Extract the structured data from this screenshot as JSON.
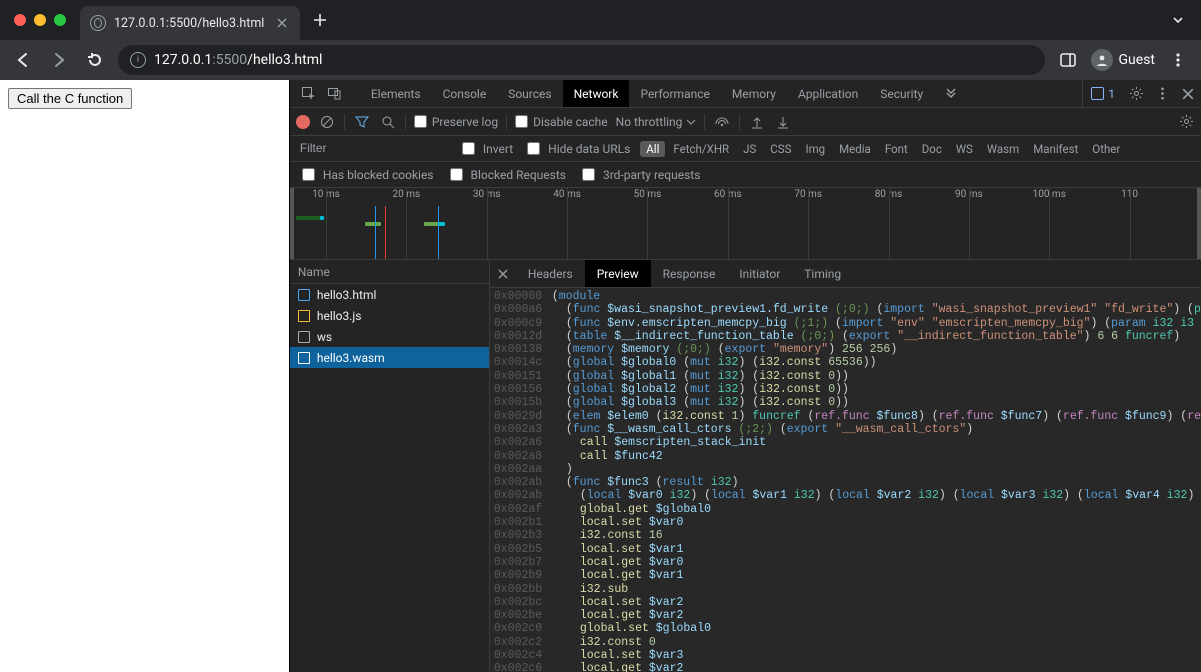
{
  "tab": {
    "title": "127.0.0.1:5500/hello3.html"
  },
  "omnibox": {
    "proto_and_port": ":5500",
    "host": "127.0.0.1",
    "path": "/hello3.html"
  },
  "guest_label": "Guest",
  "page": {
    "button_label": "Call the C function"
  },
  "devtools": {
    "tabs": [
      "Elements",
      "Console",
      "Sources",
      "Network",
      "Performance",
      "Memory",
      "Application",
      "Security"
    ],
    "active_tab_index": 3,
    "issues_count": "1",
    "net_toolbar": {
      "preserve_log": "Preserve log",
      "disable_cache": "Disable cache",
      "throttle": "No throttling"
    },
    "filter": {
      "placeholder": "Filter",
      "invert": "Invert",
      "hide_data_urls": "Hide data URLs",
      "chips": [
        "All",
        "Fetch/XHR",
        "JS",
        "CSS",
        "Img",
        "Media",
        "Font",
        "Doc",
        "WS",
        "Wasm",
        "Manifest",
        "Other"
      ],
      "active_chip_index": 0,
      "blocked_cookies": "Has blocked cookies",
      "blocked_requests": "Blocked Requests",
      "third_party": "3rd-party requests"
    },
    "timeline": {
      "ticks": [
        "10 ms",
        "20 ms",
        "30 ms",
        "40 ms",
        "50 ms",
        "60 ms",
        "70 ms",
        "80 ms",
        "90 ms",
        "100 ms",
        "110"
      ]
    },
    "reqlist": {
      "header": "Name",
      "items": [
        {
          "name": "hello3.html",
          "type": "html"
        },
        {
          "name": "hello3.js",
          "type": "js"
        },
        {
          "name": "ws",
          "type": "ws"
        },
        {
          "name": "hello3.wasm",
          "type": "wasm"
        }
      ],
      "selected_index": 3
    },
    "detail_tabs": [
      "Headers",
      "Preview",
      "Response",
      "Initiator",
      "Timing"
    ],
    "detail_active_index": 1,
    "wasm_preview": [
      {
        "addr": "0x00000",
        "indent": 0,
        "tokens": [
          [
            "pl",
            "("
          ],
          [
            "kw",
            "module"
          ]
        ]
      },
      {
        "addr": "0x000a6",
        "indent": 1,
        "tokens": [
          [
            "pl",
            "("
          ],
          [
            "kw",
            "func"
          ],
          [
            "pl",
            " "
          ],
          [
            "fn",
            "$wasi_snapshot_preview1.fd_write"
          ],
          [
            "pl",
            " "
          ],
          [
            "cm",
            "(;0;)"
          ],
          [
            "pl",
            " ("
          ],
          [
            "kw",
            "import"
          ],
          [
            "pl",
            " "
          ],
          [
            "str",
            "\"wasi_snapshot_preview1\""
          ],
          [
            "pl",
            " "
          ],
          [
            "str",
            "\"fd_write\""
          ],
          [
            "pl",
            ") ("
          ],
          [
            "ty",
            "p"
          ]
        ]
      },
      {
        "addr": "0x000c9",
        "indent": 1,
        "tokens": [
          [
            "pl",
            "("
          ],
          [
            "kw",
            "func"
          ],
          [
            "pl",
            " "
          ],
          [
            "fn",
            "$env.emscripten_memcpy_big"
          ],
          [
            "pl",
            " "
          ],
          [
            "cm",
            "(;1;)"
          ],
          [
            "pl",
            " ("
          ],
          [
            "kw",
            "import"
          ],
          [
            "pl",
            " "
          ],
          [
            "str",
            "\"env\""
          ],
          [
            "pl",
            " "
          ],
          [
            "str",
            "\"emscripten_memcpy_big\""
          ],
          [
            "pl",
            ") ("
          ],
          [
            "kw",
            "param"
          ],
          [
            "pl",
            " "
          ],
          [
            "ty",
            "i32"
          ],
          [
            "pl",
            " "
          ],
          [
            "ty",
            "i3"
          ]
        ]
      },
      {
        "addr": "0x0012d",
        "indent": 1,
        "tokens": [
          [
            "pl",
            "("
          ],
          [
            "kw",
            "table"
          ],
          [
            "pl",
            " "
          ],
          [
            "fn",
            "$__indirect_function_table"
          ],
          [
            "pl",
            " "
          ],
          [
            "cm",
            "(;0;)"
          ],
          [
            "pl",
            " ("
          ],
          [
            "kw",
            "export"
          ],
          [
            "pl",
            " "
          ],
          [
            "str",
            "\"__indirect_function_table\""
          ],
          [
            "pl",
            ") "
          ],
          [
            "num",
            "6"
          ],
          [
            "pl",
            " "
          ],
          [
            "num",
            "6"
          ],
          [
            "pl",
            " "
          ],
          [
            "ty",
            "funcref"
          ],
          [
            "pl",
            ")"
          ]
        ]
      },
      {
        "addr": "0x00138",
        "indent": 1,
        "tokens": [
          [
            "pl",
            "("
          ],
          [
            "kw",
            "memory"
          ],
          [
            "pl",
            " "
          ],
          [
            "fn",
            "$memory"
          ],
          [
            "pl",
            " "
          ],
          [
            "cm",
            "(;0;)"
          ],
          [
            "pl",
            " ("
          ],
          [
            "kw",
            "export"
          ],
          [
            "pl",
            " "
          ],
          [
            "str",
            "\"memory\""
          ],
          [
            "pl",
            ") "
          ],
          [
            "num",
            "256"
          ],
          [
            "pl",
            " "
          ],
          [
            "num",
            "256"
          ],
          [
            "pl",
            ")"
          ]
        ]
      },
      {
        "addr": "0x0014c",
        "indent": 1,
        "tokens": [
          [
            "pl",
            "("
          ],
          [
            "kw",
            "global"
          ],
          [
            "pl",
            " "
          ],
          [
            "fn",
            "$global0"
          ],
          [
            "pl",
            " ("
          ],
          [
            "kw",
            "mut"
          ],
          [
            "pl",
            " "
          ],
          [
            "ty",
            "i32"
          ],
          [
            "pl",
            ") ("
          ],
          [
            "yl",
            "i32.const"
          ],
          [
            "pl",
            " "
          ],
          [
            "num",
            "65536"
          ],
          [
            "pl",
            "))"
          ]
        ]
      },
      {
        "addr": "0x00151",
        "indent": 1,
        "tokens": [
          [
            "pl",
            "("
          ],
          [
            "kw",
            "global"
          ],
          [
            "pl",
            " "
          ],
          [
            "fn",
            "$global1"
          ],
          [
            "pl",
            " ("
          ],
          [
            "kw",
            "mut"
          ],
          [
            "pl",
            " "
          ],
          [
            "ty",
            "i32"
          ],
          [
            "pl",
            ") ("
          ],
          [
            "yl",
            "i32.const"
          ],
          [
            "pl",
            " "
          ],
          [
            "num",
            "0"
          ],
          [
            "pl",
            "))"
          ]
        ]
      },
      {
        "addr": "0x00156",
        "indent": 1,
        "tokens": [
          [
            "pl",
            "("
          ],
          [
            "kw",
            "global"
          ],
          [
            "pl",
            " "
          ],
          [
            "fn",
            "$global2"
          ],
          [
            "pl",
            " ("
          ],
          [
            "kw",
            "mut"
          ],
          [
            "pl",
            " "
          ],
          [
            "ty",
            "i32"
          ],
          [
            "pl",
            ") ("
          ],
          [
            "yl",
            "i32.const"
          ],
          [
            "pl",
            " "
          ],
          [
            "num",
            "0"
          ],
          [
            "pl",
            "))"
          ]
        ]
      },
      {
        "addr": "0x0015b",
        "indent": 1,
        "tokens": [
          [
            "pl",
            "("
          ],
          [
            "kw",
            "global"
          ],
          [
            "pl",
            " "
          ],
          [
            "fn",
            "$global3"
          ],
          [
            "pl",
            " ("
          ],
          [
            "kw",
            "mut"
          ],
          [
            "pl",
            " "
          ],
          [
            "ty",
            "i32"
          ],
          [
            "pl",
            ") ("
          ],
          [
            "yl",
            "i32.const"
          ],
          [
            "pl",
            " "
          ],
          [
            "num",
            "0"
          ],
          [
            "pl",
            "))"
          ]
        ]
      },
      {
        "addr": "0x0029d",
        "indent": 1,
        "tokens": [
          [
            "pl",
            "("
          ],
          [
            "kw",
            "elem"
          ],
          [
            "pl",
            " "
          ],
          [
            "fn",
            "$elem0"
          ],
          [
            "pl",
            " ("
          ],
          [
            "yl",
            "i32.const"
          ],
          [
            "pl",
            " "
          ],
          [
            "num",
            "1"
          ],
          [
            "pl",
            ") "
          ],
          [
            "ty",
            "funcref"
          ],
          [
            "pl",
            " ("
          ],
          [
            "ref",
            "ref.func"
          ],
          [
            "pl",
            " "
          ],
          [
            "fn",
            "$func8"
          ],
          [
            "pl",
            ") ("
          ],
          [
            "ref",
            "ref.func"
          ],
          [
            "pl",
            " "
          ],
          [
            "fn",
            "$func7"
          ],
          [
            "pl",
            ") ("
          ],
          [
            "ref",
            "ref.func"
          ],
          [
            "pl",
            " "
          ],
          [
            "fn",
            "$func9"
          ],
          [
            "pl",
            ") ("
          ],
          [
            "ref",
            "re"
          ]
        ]
      },
      {
        "addr": "0x002a3",
        "indent": 1,
        "tokens": [
          [
            "pl",
            "("
          ],
          [
            "kw",
            "func"
          ],
          [
            "pl",
            " "
          ],
          [
            "fn",
            "$__wasm_call_ctors"
          ],
          [
            "pl",
            " "
          ],
          [
            "cm",
            "(;2;)"
          ],
          [
            "pl",
            " ("
          ],
          [
            "kw",
            "export"
          ],
          [
            "pl",
            " "
          ],
          [
            "str",
            "\"__wasm_call_ctors\""
          ],
          [
            "pl",
            ")"
          ]
        ]
      },
      {
        "addr": "0x002a6",
        "indent": 2,
        "tokens": [
          [
            "yl",
            "call"
          ],
          [
            "pl",
            " "
          ],
          [
            "fn",
            "$emscripten_stack_init"
          ]
        ]
      },
      {
        "addr": "0x002a8",
        "indent": 2,
        "tokens": [
          [
            "yl",
            "call"
          ],
          [
            "pl",
            " "
          ],
          [
            "fn",
            "$func42"
          ]
        ]
      },
      {
        "addr": "0x002aa",
        "indent": 1,
        "tokens": [
          [
            "pl",
            ")"
          ]
        ]
      },
      {
        "addr": "0x002ab",
        "indent": 1,
        "tokens": [
          [
            "pl",
            "("
          ],
          [
            "kw",
            "func"
          ],
          [
            "pl",
            " "
          ],
          [
            "fn",
            "$func3"
          ],
          [
            "pl",
            " ("
          ],
          [
            "kw",
            "result"
          ],
          [
            "pl",
            " "
          ],
          [
            "ty",
            "i32"
          ],
          [
            "pl",
            ")"
          ]
        ]
      },
      {
        "addr": "0x002ab",
        "indent": 2,
        "tokens": [
          [
            "pl",
            "("
          ],
          [
            "kw",
            "local"
          ],
          [
            "pl",
            " "
          ],
          [
            "fn",
            "$var0"
          ],
          [
            "pl",
            " "
          ],
          [
            "ty",
            "i32"
          ],
          [
            "pl",
            ") ("
          ],
          [
            "kw",
            "local"
          ],
          [
            "pl",
            " "
          ],
          [
            "fn",
            "$var1"
          ],
          [
            "pl",
            " "
          ],
          [
            "ty",
            "i32"
          ],
          [
            "pl",
            ") ("
          ],
          [
            "kw",
            "local"
          ],
          [
            "pl",
            " "
          ],
          [
            "fn",
            "$var2"
          ],
          [
            "pl",
            " "
          ],
          [
            "ty",
            "i32"
          ],
          [
            "pl",
            ") ("
          ],
          [
            "kw",
            "local"
          ],
          [
            "pl",
            " "
          ],
          [
            "fn",
            "$var3"
          ],
          [
            "pl",
            " "
          ],
          [
            "ty",
            "i32"
          ],
          [
            "pl",
            ") ("
          ],
          [
            "kw",
            "local"
          ],
          [
            "pl",
            " "
          ],
          [
            "fn",
            "$var4"
          ],
          [
            "pl",
            " "
          ],
          [
            "ty",
            "i32"
          ],
          [
            "pl",
            ")"
          ]
        ]
      },
      {
        "addr": "0x002af",
        "indent": 2,
        "tokens": [
          [
            "yl",
            "global.get"
          ],
          [
            "pl",
            " "
          ],
          [
            "fn",
            "$global0"
          ]
        ]
      },
      {
        "addr": "0x002b1",
        "indent": 2,
        "tokens": [
          [
            "yl",
            "local.set"
          ],
          [
            "pl",
            " "
          ],
          [
            "fn",
            "$var0"
          ]
        ]
      },
      {
        "addr": "0x002b3",
        "indent": 2,
        "tokens": [
          [
            "yl",
            "i32.const"
          ],
          [
            "pl",
            " "
          ],
          [
            "num",
            "16"
          ]
        ]
      },
      {
        "addr": "0x002b5",
        "indent": 2,
        "tokens": [
          [
            "yl",
            "local.set"
          ],
          [
            "pl",
            " "
          ],
          [
            "fn",
            "$var1"
          ]
        ]
      },
      {
        "addr": "0x002b7",
        "indent": 2,
        "tokens": [
          [
            "yl",
            "local.get"
          ],
          [
            "pl",
            " "
          ],
          [
            "fn",
            "$var0"
          ]
        ]
      },
      {
        "addr": "0x002b9",
        "indent": 2,
        "tokens": [
          [
            "yl",
            "local.get"
          ],
          [
            "pl",
            " "
          ],
          [
            "fn",
            "$var1"
          ]
        ]
      },
      {
        "addr": "0x002bb",
        "indent": 2,
        "tokens": [
          [
            "yl",
            "i32.sub"
          ]
        ]
      },
      {
        "addr": "0x002bc",
        "indent": 2,
        "tokens": [
          [
            "yl",
            "local.set"
          ],
          [
            "pl",
            " "
          ],
          [
            "fn",
            "$var2"
          ]
        ]
      },
      {
        "addr": "0x002be",
        "indent": 2,
        "tokens": [
          [
            "yl",
            "local.get"
          ],
          [
            "pl",
            " "
          ],
          [
            "fn",
            "$var2"
          ]
        ]
      },
      {
        "addr": "0x002c0",
        "indent": 2,
        "tokens": [
          [
            "yl",
            "global.set"
          ],
          [
            "pl",
            " "
          ],
          [
            "fn",
            "$global0"
          ]
        ]
      },
      {
        "addr": "0x002c2",
        "indent": 2,
        "tokens": [
          [
            "yl",
            "i32.const"
          ],
          [
            "pl",
            " "
          ],
          [
            "num",
            "0"
          ]
        ]
      },
      {
        "addr": "0x002c4",
        "indent": 2,
        "tokens": [
          [
            "yl",
            "local.set"
          ],
          [
            "pl",
            " "
          ],
          [
            "fn",
            "$var3"
          ]
        ]
      },
      {
        "addr": "0x002c6",
        "indent": 2,
        "tokens": [
          [
            "yl",
            "local.get"
          ],
          [
            "pl",
            " "
          ],
          [
            "fn",
            "$var2"
          ]
        ]
      }
    ]
  }
}
